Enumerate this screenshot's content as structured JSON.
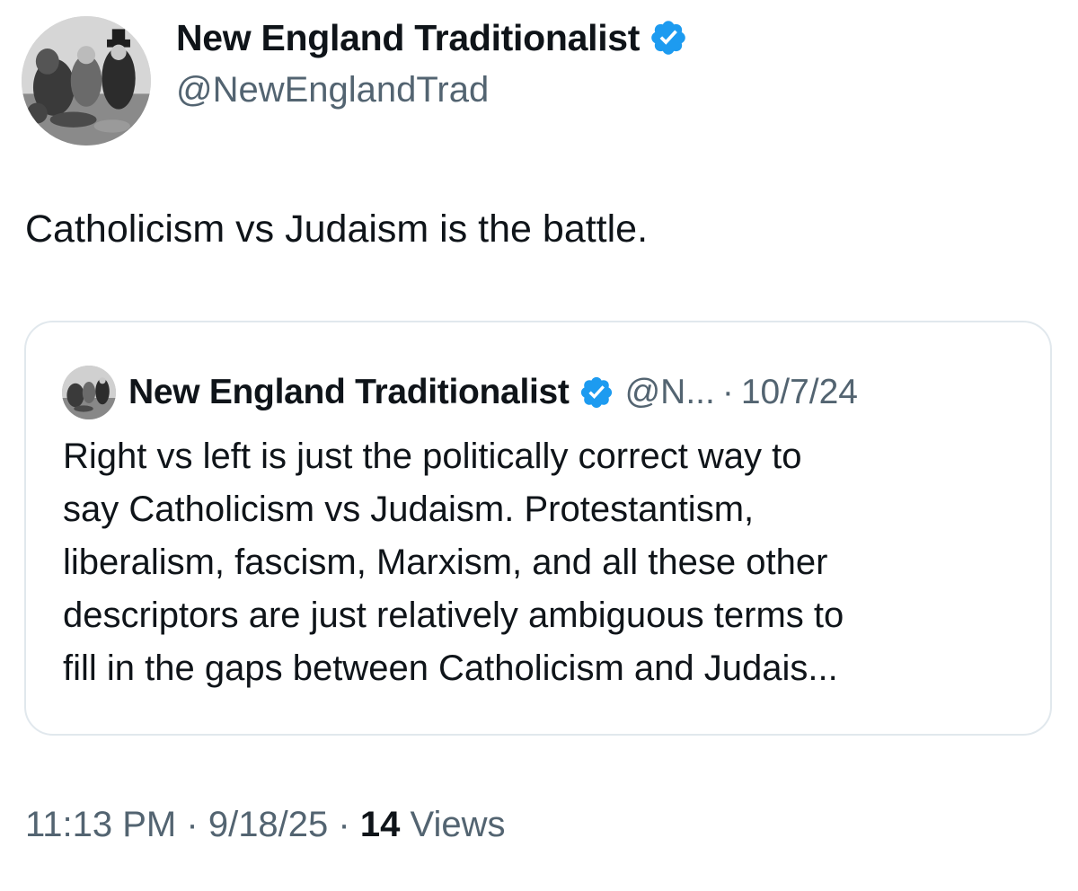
{
  "author": {
    "name": "New England Traditionalist",
    "handle": "@NewEnglandTrad",
    "avatar_icon": "profile-avatar-painting",
    "verified_icon": "verified-badge-icon",
    "verified_color": "#1d9bf0"
  },
  "tweet": {
    "text": "Catholicism vs Judaism is the battle."
  },
  "quoted_tweet": {
    "author_name": "New England Traditionalist",
    "handle": "@N...",
    "separator": "·",
    "date": "10/7/24",
    "text_lines": [
      "Right vs left is just the politically correct way to",
      "say Catholicism vs Judaism. Protestantism,",
      "liberalism, fascism, Marxism, and all these other",
      "descriptors are just relatively ambiguous terms to",
      "fill in the gaps between Catholicism and Judais..."
    ]
  },
  "meta": {
    "time": "11:13 PM",
    "separator": "·",
    "date": "9/18/25",
    "views_count": "14",
    "views_label": "Views"
  },
  "colors": {
    "text": "#0f1419",
    "secondary_text": "#536471",
    "border": "#e1e8ed",
    "verified": "#1d9bf0"
  }
}
